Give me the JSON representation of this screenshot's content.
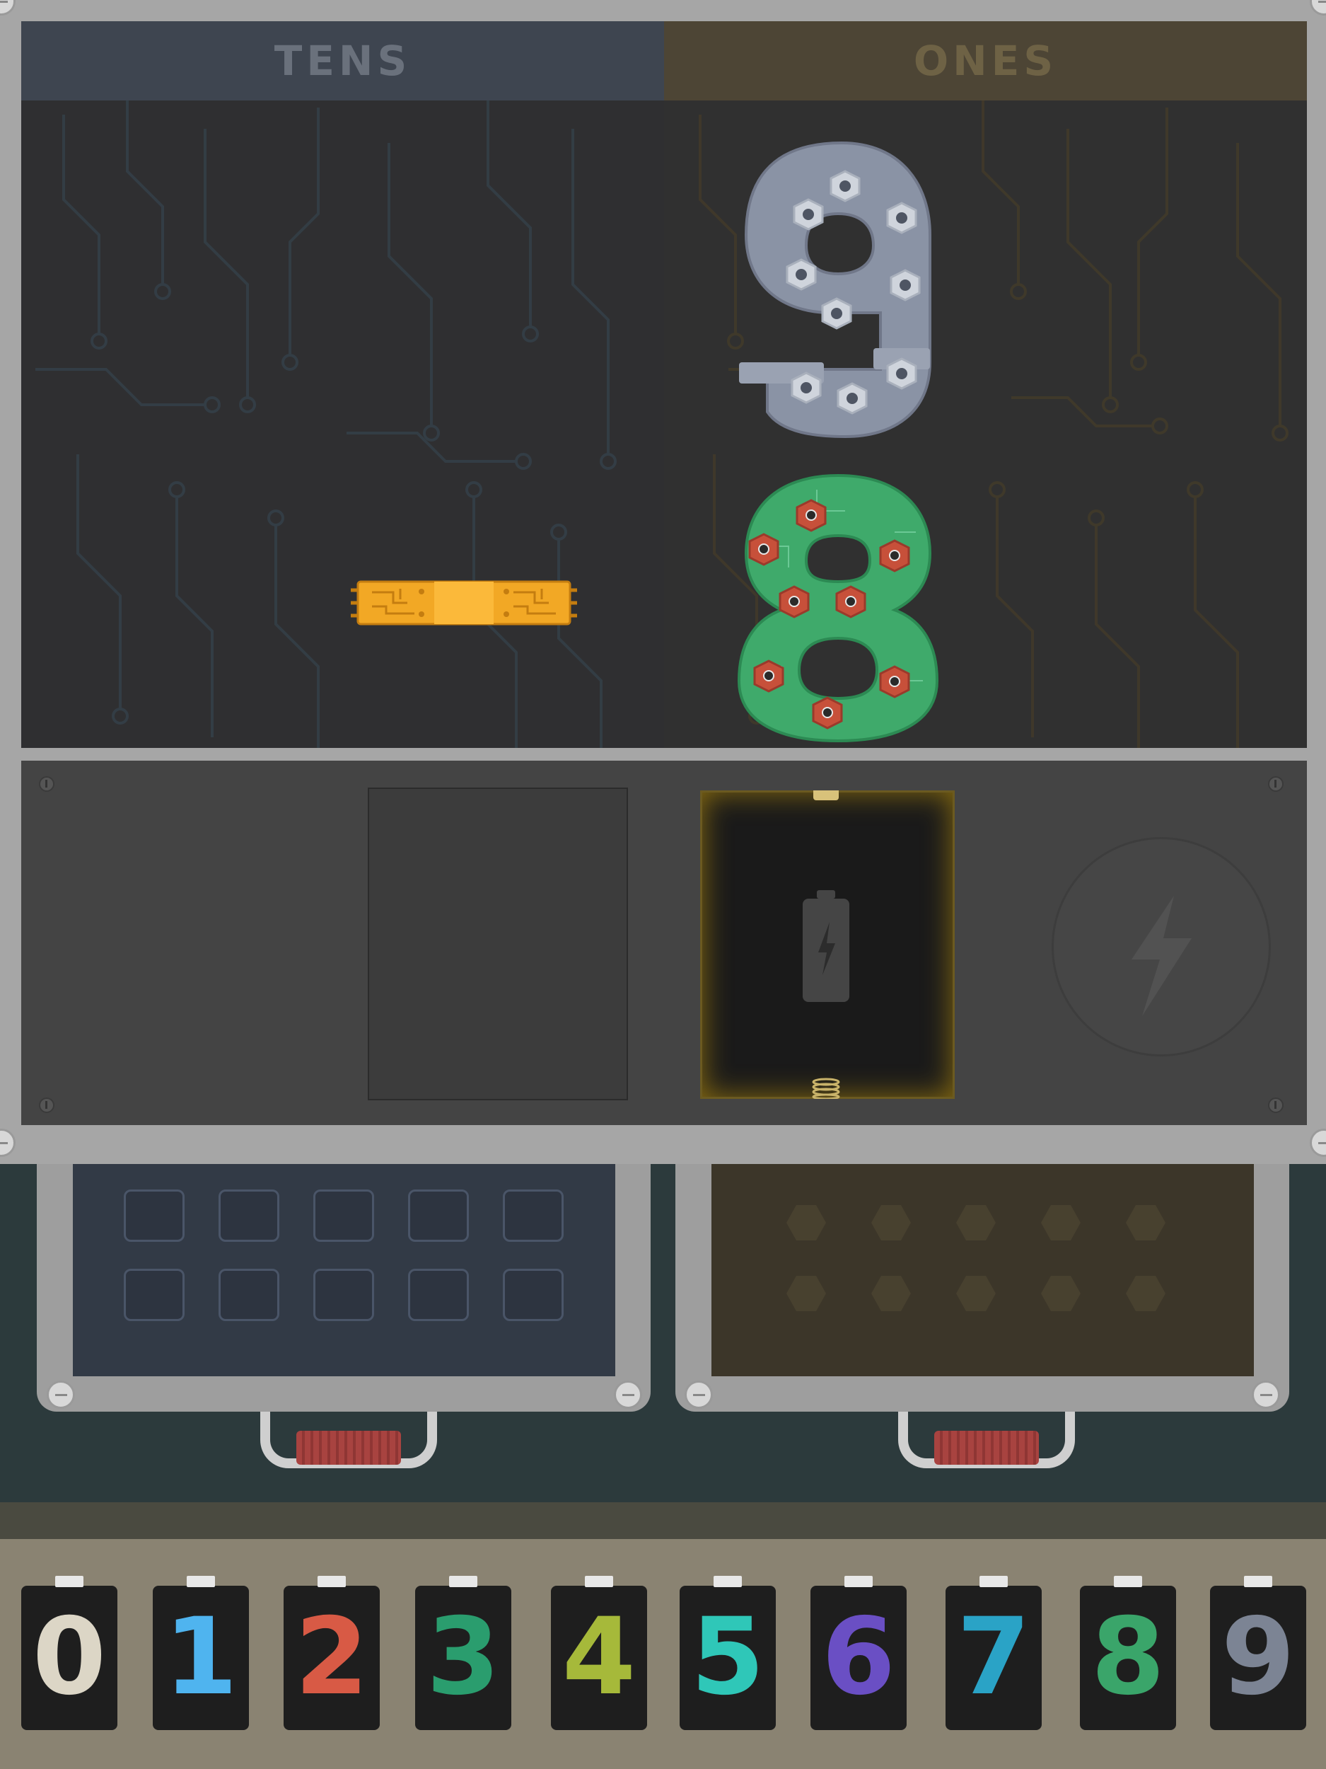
{
  "header": {
    "tens_label": "TENS",
    "ones_label": "ONES"
  },
  "board": {
    "tens_pieces": [
      "rod"
    ],
    "ones_digits": [
      "9",
      "8"
    ]
  },
  "palette": {
    "digits": [
      {
        "label": "0",
        "color": "#dcd6c6"
      },
      {
        "label": "1",
        "color": "#4fb4ef"
      },
      {
        "label": "2",
        "color": "#d85a45"
      },
      {
        "label": "3",
        "color": "#2a9d6e"
      },
      {
        "label": "4",
        "color": "#a6b93a"
      },
      {
        "label": "5",
        "color": "#2fc7b8"
      },
      {
        "label": "6",
        "color": "#6a4fc4"
      },
      {
        "label": "7",
        "color": "#2aa3c6"
      },
      {
        "label": "8",
        "color": "#3aa56a"
      },
      {
        "label": "9",
        "color": "#7c8494"
      }
    ]
  },
  "icons": {
    "battery": "battery-charge-icon",
    "power": "lightning-bolt-icon"
  }
}
